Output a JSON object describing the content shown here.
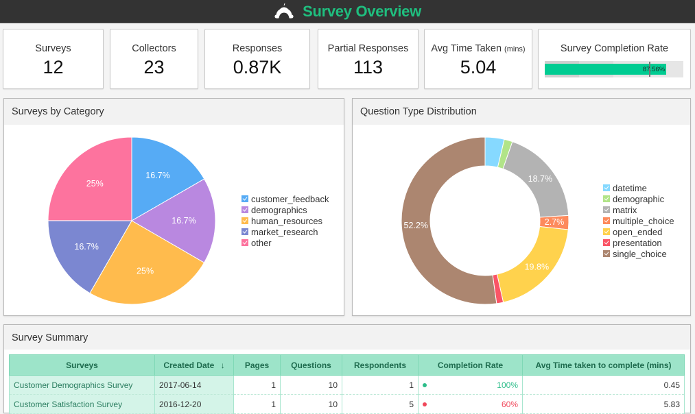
{
  "header": {
    "title": "Survey Overview",
    "logo_icon": "surveymonkey-logo-icon"
  },
  "kpis": [
    {
      "label": "Surveys",
      "value": "12"
    },
    {
      "label": "Collectors",
      "value": "23"
    },
    {
      "label": "Responses",
      "value": "0.87K"
    },
    {
      "label": "Partial Responses",
      "value": "113"
    },
    {
      "label": "Avg Time Taken",
      "label_unit": "(mins)",
      "value": "5.04"
    },
    {
      "label": "Survey Completion Rate",
      "value_text": "87.56%",
      "value": 87.56,
      "target": 75,
      "max": 100
    }
  ],
  "colors": {
    "accent": "#1fbf7f",
    "bar_fill": "#00cc92",
    "header_bg": "#333333",
    "table_header": "#9de4c9"
  },
  "panels": {
    "category": {
      "title": "Surveys by Category"
    },
    "question_type": {
      "title": "Question Type Distribution"
    },
    "summary": {
      "title": "Survey Summary"
    }
  },
  "chart_data": [
    {
      "type": "pie",
      "title": "Surveys by Category",
      "categories": [
        "customer_feedback",
        "demographics",
        "human_resources",
        "market_research",
        "other"
      ],
      "values": [
        16.7,
        16.7,
        25,
        16.7,
        25
      ],
      "labels": [
        "16.7%",
        "16.7%",
        "25%",
        "16.7%",
        "25%"
      ],
      "colors": [
        "#56abf5",
        "#b988e0",
        "#ffbb4d",
        "#7b87d1",
        "#fd739e"
      ],
      "legend": "right"
    },
    {
      "type": "pie",
      "subtype": "donut",
      "title": "Question Type Distribution",
      "categories": [
        "datetime",
        "demographic",
        "matrix",
        "multiple_choice",
        "open_ended",
        "presentation",
        "single_choice"
      ],
      "values": [
        3.7,
        1.6,
        18.7,
        2.7,
        19.8,
        1.3,
        52.2
      ],
      "labels": [
        "",
        "",
        "18.7%",
        "2.7%",
        "19.8%",
        "",
        "52.2%"
      ],
      "colors": [
        "#86d9ff",
        "#b1e488",
        "#b3b3b3",
        "#fd8a5c",
        "#ffd24d",
        "#fa5566",
        "#ac8670"
      ],
      "legend": "right"
    }
  ],
  "table": {
    "columns": [
      "Surveys",
      "Created Date",
      "Pages",
      "Questions",
      "Respondents",
      "Completion Rate",
      "Avg Time taken to complete (mins)"
    ],
    "sort_icon": "arrow-down-icon",
    "rows": [
      {
        "survey": "Customer Demographics Survey",
        "date": "2017-06-14",
        "pages": "1",
        "questions": "10",
        "respondents": "1",
        "completion": "100%",
        "completion_color": "#2dbd8a",
        "avg_time": "0.45"
      },
      {
        "survey": "Customer Satisfaction Survey",
        "date": "2016-12-20",
        "pages": "1",
        "questions": "10",
        "respondents": "5",
        "completion": "60%",
        "completion_color": "#f0475a",
        "avg_time": "5.83"
      }
    ]
  }
}
